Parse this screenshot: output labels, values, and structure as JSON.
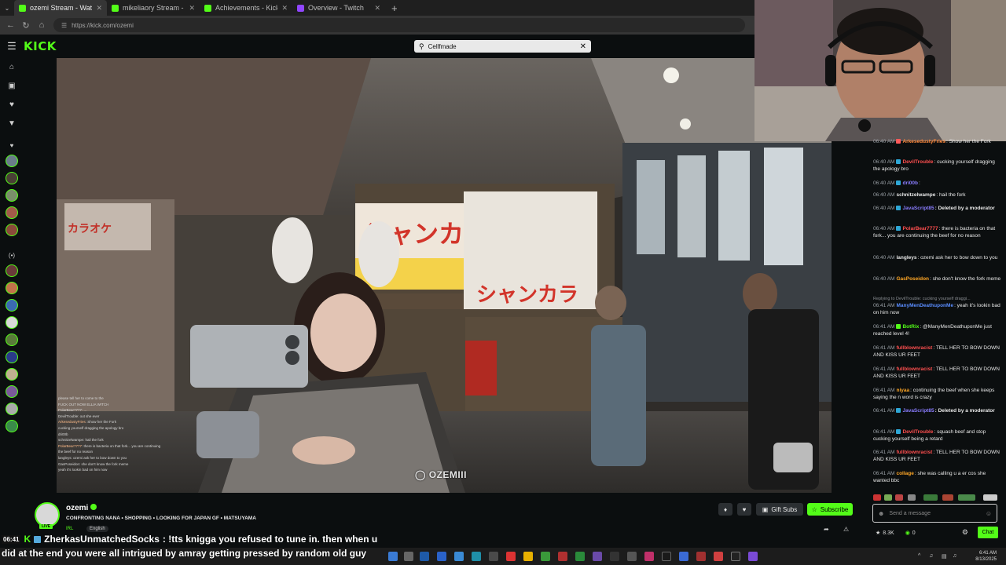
{
  "browser": {
    "tabs": [
      {
        "label": "ozemi Stream - Watch Live o",
        "color": "#53fc18",
        "active": true
      },
      {
        "label": "mikeliaory Stream - Watch Liv",
        "color": "#53fc18",
        "active": false
      },
      {
        "label": "Achievements - Kick Dashboard",
        "color": "#53fc18",
        "active": false
      },
      {
        "label": "Overview - Twitch",
        "color": "#9146ff",
        "active": false
      }
    ],
    "new_tab": "+",
    "url": "https://kick.com/ozemi"
  },
  "kick": {
    "logo": "KICK",
    "search_value": "Cellfmade"
  },
  "video": {
    "watermark": "OZEMIII",
    "overlay_chat": [
      {
        "user": "",
        "text": "please tell her to come to the"
      },
      {
        "user": "",
        "text": "FUCK OUT NOW ELLIA WITCH"
      },
      {
        "user": "",
        "text": "PolarBear7777: ..."
      },
      {
        "user": "",
        "text": "DevilTrouble: out she ever"
      },
      {
        "user": "ArkesedustyFries",
        "text": ": Show her the Fork"
      },
      {
        "user": "",
        "text": "cucking yourself dragging the apology bro"
      },
      {
        "user": "",
        "text": "dri00b"
      },
      {
        "user": "",
        "text": "schnitzelwampe: hail the fork"
      },
      {
        "user": "PolarBear7777",
        "text": ": there is bacteria on that fork... you are continuing"
      },
      {
        "user": "",
        "text": "the beef for no reason"
      },
      {
        "user": "",
        "text": "langleys: ozemi ask her to bow down to you"
      },
      {
        "user": "",
        "text": "GasPoseidon: she don't know the fork meme"
      },
      {
        "user": "",
        "text": "yeah it's lookin bad on him now"
      }
    ]
  },
  "chat": {
    "messages": [
      {
        "time": "06:40 AM",
        "user": "ArkesedustyFries",
        "color": "#ff8a3d",
        "text": ": Show her the Fork",
        "badge": "#ff5a5a"
      },
      {
        "time": "06:40 AM",
        "user": "DevilTrouble",
        "color": "#ff4f4f",
        "text": ": cucking yourself dragging the apology bro",
        "badge": "#2ea7d6"
      },
      {
        "time": "06:40 AM",
        "user": "dri00b",
        "color": "#8a7dff",
        "text": ":",
        "badge": "#2ea7d6"
      },
      {
        "time": "06:40 AM",
        "user": "schnitzelwampe",
        "color": "#e8e8e8",
        "text": ": hail the fork",
        "badge": ""
      },
      {
        "time": "06:40 AM",
        "user": "JavaScript85",
        "color": "#8a7dff",
        "text": ": Deleted by a moderator",
        "badge": "#2ea7d6"
      },
      {
        "time": "06:40 AM",
        "user": "PolarBear7777",
        "color": "#ff4f4f",
        "text": ": there is bacteria on that fork... you are continuing the beef for no reason",
        "badge": "#2ea7d6"
      },
      {
        "time": "06:40 AM",
        "user": "langleys",
        "color": "#e8e8e8",
        "text": ": ozemi ask her to bow down to you",
        "badge": ""
      },
      {
        "time": "06:40 AM",
        "user": "GasPoseidon",
        "color": "#ffa726",
        "text": ": she don't know the fork meme",
        "badge": ""
      },
      {
        "time": "06:41 AM",
        "user": "ManyMenDeathuponMe",
        "color": "#5a8dff",
        "text": ": yeah it's lookin bad on him now",
        "badge": ""
      },
      {
        "time": "06:41 AM",
        "user": "BotRix",
        "color": "#53fc18",
        "text": ": @ManyMenDeathuponMe just reached level 4!",
        "badge": "#53fc18"
      },
      {
        "time": "06:41 AM",
        "user": "fullblownracist",
        "color": "#ff4f4f",
        "text": ": TELL HER TO BOW DOWN AND KISS UR FEET",
        "badge": ""
      },
      {
        "time": "06:41 AM",
        "user": "fullblownracist",
        "color": "#ff4f4f",
        "text": ": TELL HER TO BOW DOWN AND KISS UR FEET",
        "badge": ""
      },
      {
        "time": "06:41 AM",
        "user": "niyaa",
        "color": "#ffa726",
        "text": ": continuing the beef when she keeps saying the n word is crazy",
        "badge": ""
      },
      {
        "time": "06:41 AM",
        "user": "JavaScript85",
        "color": "#8a7dff",
        "text": ": Deleted by a moderator",
        "badge": "#2ea7d6"
      },
      {
        "time": "06:41 AM",
        "user": "DevilTrouble",
        "color": "#ff4f4f",
        "text": ": squash beef and stop cucking yourself being a retard",
        "badge": "#2ea7d6"
      },
      {
        "time": "06:41 AM",
        "user": "fullblownracist",
        "color": "#ff4f4f",
        "text": ": TELL HER TO BOW DOWN AND KISS UR FEET",
        "badge": ""
      },
      {
        "time": "06:41 AM",
        "user": "collage",
        "color": "#ffa726",
        "text": ": she was calling u a er cos she wanted bbc",
        "badge": ""
      }
    ],
    "reply_hint": "Replying to DevilTrouble: cucking yourself draggi...",
    "input_placeholder": "Send a message",
    "viewers": "8.3K",
    "points": "0",
    "chat_button": "Chat"
  },
  "stream": {
    "streamer": "ozemi",
    "title": "CONFRONTING NANA • SHOPPING • LOOKING FOR JAPAN GF • MATSUYAMA",
    "category": "IRL",
    "language": "English",
    "live": "LIVE",
    "gift_subs": "Gift Subs",
    "subscribe": "Subscribe"
  },
  "subtitles": {
    "time": "06:41",
    "user": "ZherkasUnmatchedSocks",
    "line1": ": !tts knigga you refused to tune in. then when u",
    "line2": "did at the end you were all intrigued by amray getting pressed by random old guy"
  },
  "taskbar": {
    "time": "6:41 AM",
    "date": "8/13/2025"
  },
  "colors": {
    "kick_green": "#53fc18",
    "background": "#0b0e0f"
  }
}
